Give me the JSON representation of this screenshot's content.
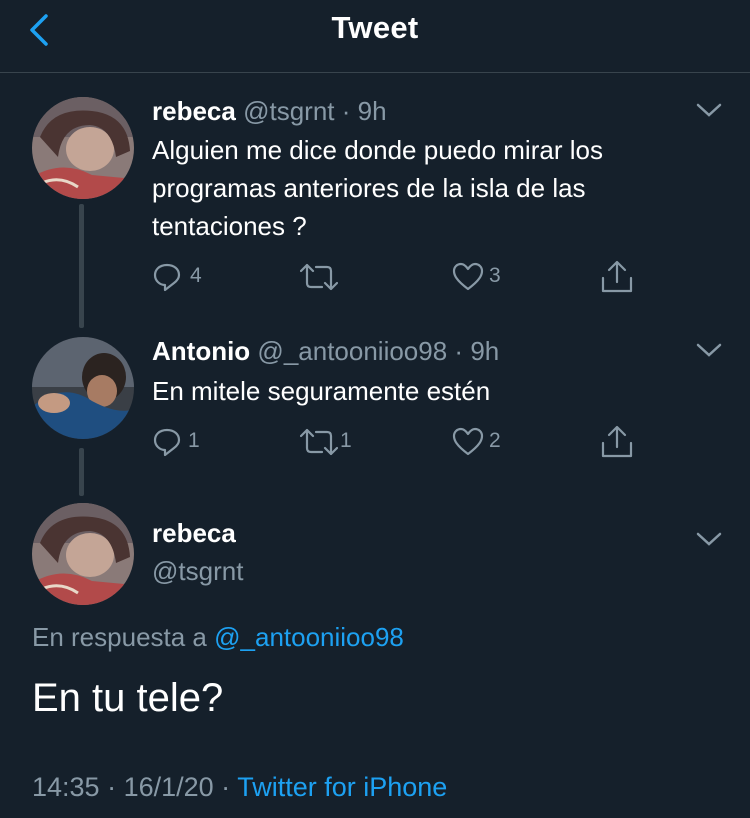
{
  "header": {
    "title": "Tweet"
  },
  "tweets": [
    {
      "name": "rebeca",
      "handle": "@tsgrnt",
      "time": "9h",
      "text": "Alguien me dice donde puedo mirar los programas anteriores de la isla de las tentaciones ?",
      "replies": "4",
      "retweets": "",
      "likes": "3"
    },
    {
      "name": "Antonio",
      "handle": "@_antooniioo98",
      "time": "9h",
      "text": "En mitele seguramente estén",
      "replies": "1",
      "retweets": "1",
      "likes": "2"
    }
  ],
  "focus": {
    "name": "rebeca",
    "handle": "@tsgrnt",
    "reply_prefix": "En respuesta a",
    "reply_handle": "@_antooniioo98",
    "text": "En tu tele?",
    "time": "14:35",
    "date": "16/1/20",
    "source": "Twitter for iPhone"
  },
  "colors": {
    "background": "#15202b",
    "secondary_text": "#8899a6",
    "accent": "#1da1f2",
    "divider": "#38444d"
  },
  "icons": [
    "back-chevron-icon",
    "reply-icon",
    "retweet-icon",
    "like-icon",
    "share-icon",
    "chevron-down-icon"
  ]
}
